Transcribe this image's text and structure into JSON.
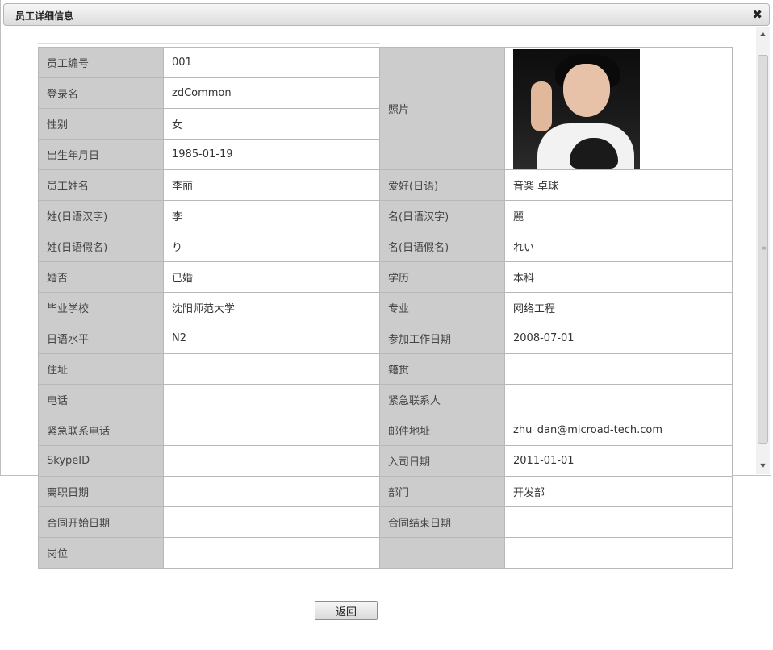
{
  "dialog": {
    "title": "员工详细信息",
    "close_glyph": "✖",
    "back_label": "返回"
  },
  "scrollbar": {
    "up_glyph": "▲",
    "down_glyph": "▼",
    "grip_glyph": "≡"
  },
  "employee": {
    "top_left": [
      {
        "label": "员工编号",
        "value": "001"
      },
      {
        "label": "登录名",
        "value": "zdCommon"
      },
      {
        "label": "性别",
        "value": "女"
      },
      {
        "label": "出生年月日",
        "value": "1985-01-19"
      }
    ],
    "photo_label": "照片",
    "rows": [
      {
        "label1": "员工姓名",
        "value1": "李丽",
        "label2": "爱好(日语)",
        "value2": "音楽 卓球"
      },
      {
        "label1": "姓(日语汉字)",
        "value1": "李",
        "label2": "名(日语汉字)",
        "value2": "麗"
      },
      {
        "label1": "姓(日语假名)",
        "value1": "り",
        "label2": "名(日语假名)",
        "value2": "れい"
      },
      {
        "label1": "婚否",
        "value1": "已婚",
        "label2": "学历",
        "value2": "本科"
      },
      {
        "label1": "毕业学校",
        "value1": "沈阳师范大学",
        "label2": "专业",
        "value2": "网络工程"
      },
      {
        "label1": "日语水平",
        "value1": "N2",
        "label2": "参加工作日期",
        "value2": "2008-07-01"
      },
      {
        "label1": "住址",
        "value1": "",
        "label2": "籍贯",
        "value2": ""
      },
      {
        "label1": "电话",
        "value1": "",
        "label2": "紧急联系人",
        "value2": ""
      },
      {
        "label1": "紧急联系电话",
        "value1": "",
        "label2": "邮件地址",
        "value2": "zhu_dan@microad-tech.com"
      },
      {
        "label1": "SkypeID",
        "value1": "",
        "label2": "入司日期",
        "value2": "2011-01-01"
      },
      {
        "label1": "离职日期",
        "value1": "",
        "label2": "部门",
        "value2": "开发部"
      },
      {
        "label1": "合同开始日期",
        "value1": "",
        "label2": "合同结束日期",
        "value2": ""
      },
      {
        "label1": "岗位",
        "value1": "",
        "label2": "",
        "value2": ""
      }
    ]
  }
}
